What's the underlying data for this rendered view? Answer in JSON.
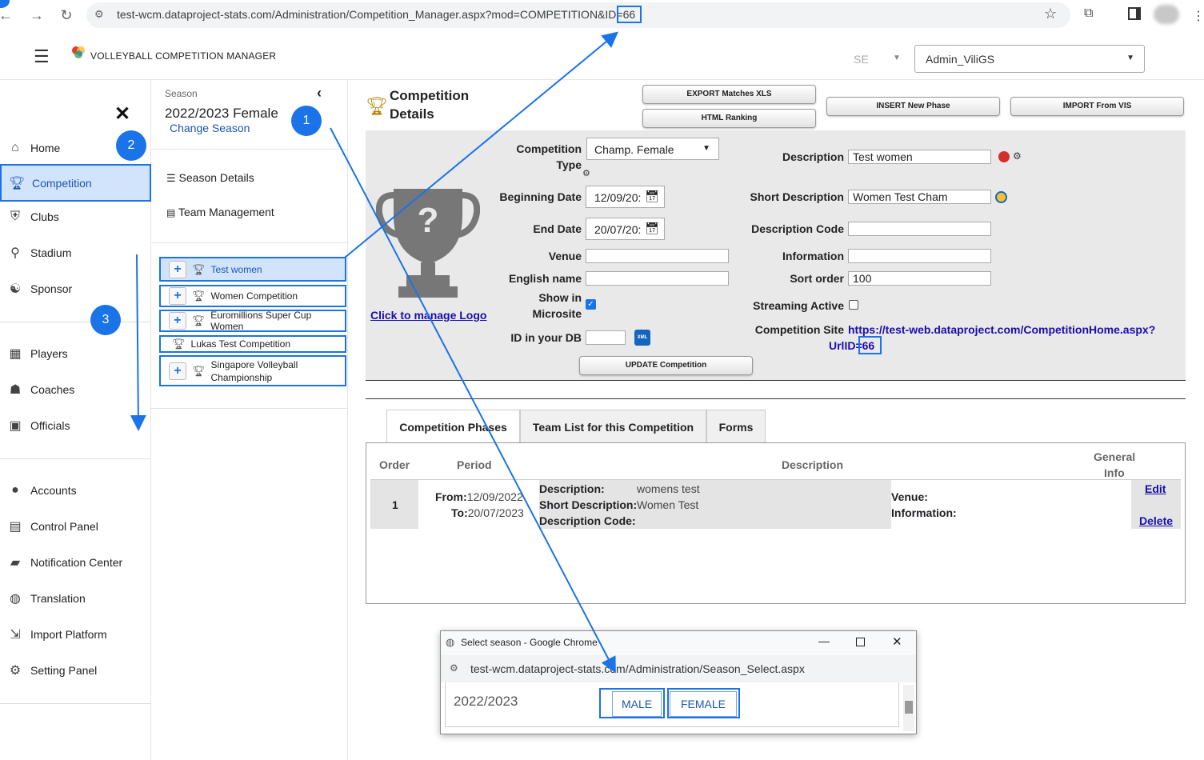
{
  "browser": {
    "url": "test-wcm.dataproject-stats.com/Administration/Competition_Manager.aspx?mod=COMPETITION&ID=66"
  },
  "header": {
    "app_title": "VOLLEYBALL COMPETITION MANAGER",
    "language": "SE",
    "user": "Admin_ViliGS"
  },
  "sidebar": {
    "items": [
      {
        "label": "Home",
        "icon": "home-icon"
      },
      {
        "label": "Competition",
        "icon": "trophy-icon"
      },
      {
        "label": "Clubs",
        "icon": "shield-icon"
      },
      {
        "label": "Stadium",
        "icon": "map-pin-icon"
      },
      {
        "label": "Sponsor",
        "icon": "handshake-icon"
      },
      {
        "label": "Players",
        "icon": "players-icon"
      },
      {
        "label": "Coaches",
        "icon": "coach-icon"
      },
      {
        "label": "Officials",
        "icon": "badge-icon"
      },
      {
        "label": "Accounts",
        "icon": "user-icon"
      },
      {
        "label": "Control Panel",
        "icon": "calendar-icon"
      },
      {
        "label": "Notification Center",
        "icon": "chat-alert-icon"
      },
      {
        "label": "Translation",
        "icon": "globe-icon"
      },
      {
        "label": "Import Platform",
        "icon": "import-icon"
      },
      {
        "label": "Setting Panel",
        "icon": "gear-icon"
      }
    ]
  },
  "season": {
    "label": "Season",
    "name": "2022/2023 Female",
    "change": "Change Season",
    "details": "Season Details",
    "team_management": "Team Management",
    "competitions": [
      "Test women",
      "Women Competition",
      "Euromillions Super Cup Women",
      "Lukas Test Competition",
      "Singapore Volleyball Championship"
    ]
  },
  "main": {
    "title_line1": "Competition",
    "title_line2": "Details",
    "buttons": {
      "export": "EXPORT Matches XLS",
      "html_ranking": "HTML Ranking",
      "insert_phase": "INSERT New Phase",
      "import_vis": "IMPORT From VIS",
      "update": "UPDATE Competition"
    },
    "logo_link": "Click to manage Logo",
    "form": {
      "type_label_1": "Competition",
      "type_label_2": "Type",
      "type_value": "Champ. Female",
      "begin_label": "Beginning Date",
      "begin_value": "12/09/20:",
      "end_label": "End Date",
      "end_value": "20/07/20:",
      "venue_label": "Venue",
      "venue_value": "",
      "english_label": "English name",
      "english_value": "",
      "microsite_label_1": "Show in",
      "microsite_label_2": "Microsite",
      "dbid_label": "ID in your DB",
      "dbid_value": "",
      "desc_label": "Description",
      "desc_value": "Test women",
      "short_label": "Short Description",
      "short_value": "Women Test Cham",
      "code_label": "Description Code",
      "code_value": "",
      "info_label": "Information",
      "info_value": "",
      "sort_label": "Sort order",
      "sort_value": "100",
      "stream_label": "Streaming Active",
      "site_label": "Competition Site",
      "site_url_1": "https://test-web.dataproject.com/CompetitionHome.aspx?",
      "site_url_2a": "UrlI",
      "site_url_2b": "D=66"
    },
    "tabs": [
      "Competition Phases",
      "Team List for this Competition",
      "Forms"
    ],
    "phases": {
      "headers": {
        "order": "Order",
        "period": "Period",
        "description": "Description",
        "general_1": "General",
        "general_2": "Info"
      },
      "row": {
        "order": "1",
        "from_label": "From:",
        "from": "12/09/2022",
        "to_label": "To:",
        "to": "20/07/2023",
        "desc_label": "Description:",
        "desc": "womens test",
        "short_label": "Short Description:",
        "short": "Women Test",
        "code_label": "Description Code:",
        "venue_label": "Venue:",
        "info_label": "Information:",
        "edit": "Edit",
        "delete": "Delete"
      }
    }
  },
  "popup": {
    "title": "Select season - Google Chrome",
    "url": "test-wcm.dataproject-stats.com/Administration/Season_Select.aspx",
    "season": "2022/2023",
    "male": "MALE",
    "female": "FEMALE"
  },
  "callouts": [
    "1",
    "2",
    "3"
  ]
}
